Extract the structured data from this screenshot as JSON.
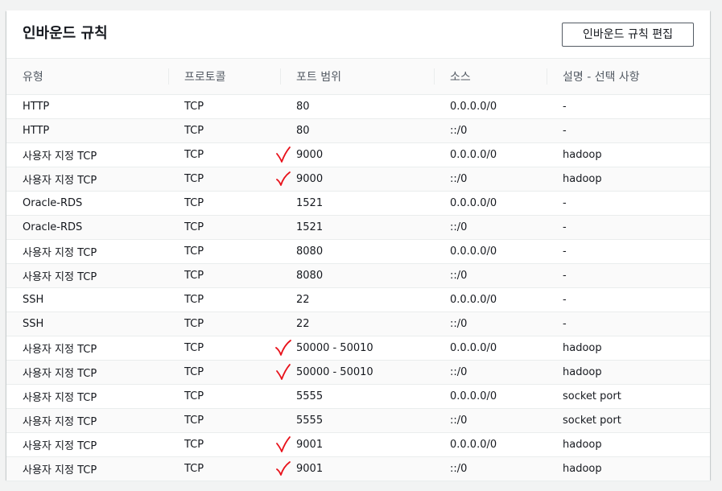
{
  "panel": {
    "title": "인바운드 규칙",
    "edit_button_label": "인바운드 규칙 편집"
  },
  "table": {
    "columns": [
      "유형",
      "프로토콜",
      "포트 범위",
      "소스",
      "설명 - 선택 사항"
    ],
    "rows": [
      {
        "type": "HTTP",
        "protocol": "TCP",
        "port": "80",
        "source": "0.0.0.0/0",
        "description": "-",
        "checked": false
      },
      {
        "type": "HTTP",
        "protocol": "TCP",
        "port": "80",
        "source": "::/0",
        "description": "-",
        "checked": false
      },
      {
        "type": "사용자 지정 TCP",
        "protocol": "TCP",
        "port": "9000",
        "source": "0.0.0.0/0",
        "description": "hadoop",
        "checked": true
      },
      {
        "type": "사용자 지정 TCP",
        "protocol": "TCP",
        "port": "9000",
        "source": "::/0",
        "description": "hadoop",
        "checked": true
      },
      {
        "type": "Oracle-RDS",
        "protocol": "TCP",
        "port": "1521",
        "source": "0.0.0.0/0",
        "description": "-",
        "checked": false
      },
      {
        "type": "Oracle-RDS",
        "protocol": "TCP",
        "port": "1521",
        "source": "::/0",
        "description": "-",
        "checked": false
      },
      {
        "type": "사용자 지정 TCP",
        "protocol": "TCP",
        "port": "8080",
        "source": "0.0.0.0/0",
        "description": "-",
        "checked": false
      },
      {
        "type": "사용자 지정 TCP",
        "protocol": "TCP",
        "port": "8080",
        "source": "::/0",
        "description": "-",
        "checked": false
      },
      {
        "type": "SSH",
        "protocol": "TCP",
        "port": "22",
        "source": "0.0.0.0/0",
        "description": "-",
        "checked": false
      },
      {
        "type": "SSH",
        "protocol": "TCP",
        "port": "22",
        "source": "::/0",
        "description": "-",
        "checked": false
      },
      {
        "type": "사용자 지정 TCP",
        "protocol": "TCP",
        "port": "50000 - 50010",
        "source": "0.0.0.0/0",
        "description": "hadoop",
        "checked": true
      },
      {
        "type": "사용자 지정 TCP",
        "protocol": "TCP",
        "port": "50000 - 50010",
        "source": "::/0",
        "description": "hadoop",
        "checked": true
      },
      {
        "type": "사용자 지정 TCP",
        "protocol": "TCP",
        "port": "5555",
        "source": "0.0.0.0/0",
        "description": "socket port",
        "checked": false
      },
      {
        "type": "사용자 지정 TCP",
        "protocol": "TCP",
        "port": "5555",
        "source": "::/0",
        "description": "socket port",
        "checked": false
      },
      {
        "type": "사용자 지정 TCP",
        "protocol": "TCP",
        "port": "9001",
        "source": "0.0.0.0/0",
        "description": "hadoop",
        "checked": true
      },
      {
        "type": "사용자 지정 TCP",
        "protocol": "TCP",
        "port": "9001",
        "source": "::/0",
        "description": "hadoop",
        "checked": true
      }
    ]
  },
  "annotation": {
    "mark_icon": "red-checkmark",
    "mark_color": "#e8111a"
  }
}
